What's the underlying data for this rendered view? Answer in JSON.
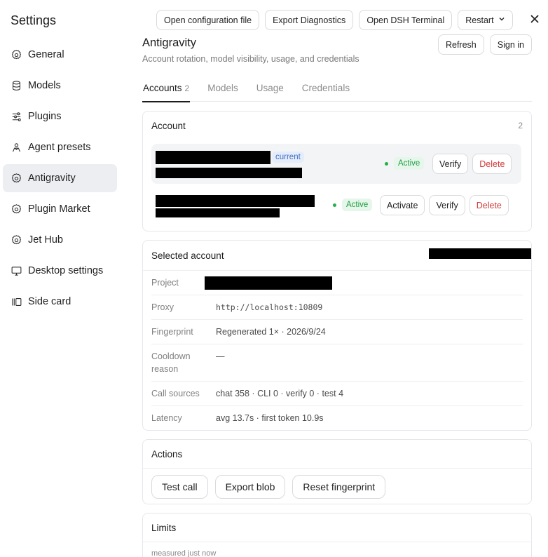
{
  "sidebar": {
    "title": "Settings",
    "items": [
      {
        "label": "General",
        "icon": "gear-icon"
      },
      {
        "label": "Models",
        "icon": "database-icon"
      },
      {
        "label": "Plugins",
        "icon": "sliders-icon"
      },
      {
        "label": "Agent presets",
        "icon": "agent-icon"
      },
      {
        "label": "Antigravity",
        "icon": "gear-icon"
      },
      {
        "label": "Plugin Market",
        "icon": "gear-icon"
      },
      {
        "label": "Jet Hub",
        "icon": "gear-icon"
      },
      {
        "label": "Desktop settings",
        "icon": "monitor-icon"
      },
      {
        "label": "Side card",
        "icon": "side-card-icon"
      }
    ],
    "active_index": 4
  },
  "toolbar": {
    "open_config": "Open configuration file",
    "export_diag": "Export Diagnostics",
    "open_terminal": "Open DSH Terminal",
    "restart": "Restart"
  },
  "header": {
    "title": "Antigravity",
    "subtitle": "Account rotation, model visibility, usage, and credentials",
    "refresh": "Refresh",
    "sign_in": "Sign in"
  },
  "tabs": [
    {
      "label": "Accounts",
      "count": "2"
    },
    {
      "label": "Models",
      "count": ""
    },
    {
      "label": "Usage",
      "count": ""
    },
    {
      "label": "Credentials",
      "count": ""
    }
  ],
  "account_card": {
    "title": "Account",
    "count": "2",
    "current_chip": "current",
    "rows": [
      {
        "status": "Active",
        "verify": "Verify",
        "delete": "Delete"
      },
      {
        "status": "Active",
        "activate": "Activate",
        "verify": "Verify",
        "delete": "Delete"
      }
    ]
  },
  "selected": {
    "title": "Selected account",
    "fields": [
      {
        "key": "Project",
        "value": ""
      },
      {
        "key": "Proxy",
        "value": "http://localhost:10809"
      },
      {
        "key": "Fingerprint",
        "value": "Regenerated 1× · 2026/9/24"
      },
      {
        "key": "Cooldown reason",
        "value": "—"
      },
      {
        "key": "Call sources",
        "value": "chat 358 · CLI 0 · verify 0 · test 4"
      },
      {
        "key": "Latency",
        "value": "avg 13.7s · first token 10.9s"
      }
    ]
  },
  "actions": {
    "title": "Actions",
    "test_call": "Test call",
    "export_blob": "Export blob",
    "reset_fp": "Reset fingerprint"
  },
  "limits": {
    "title": "Limits",
    "measured": "measured just now"
  },
  "colors": {
    "active_green": "#1f9e45",
    "danger_red": "#d23a3a",
    "current_blue": "#3f6fc6",
    "selected_nav": "#eceef1"
  }
}
